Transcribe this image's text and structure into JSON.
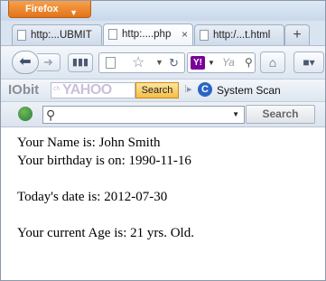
{
  "browser": {
    "menu_button": "Firefox",
    "tabs": [
      {
        "title": "http:...UBMIT",
        "active": false
      },
      {
        "title": "http:....php",
        "active": true
      },
      {
        "title": "http:/...t.html",
        "active": false
      }
    ],
    "new_tab_symbol": "+",
    "close_tab_symbol": "×"
  },
  "navbar": {
    "search_placeholder": "Ya",
    "search_engine_icon": "Y!"
  },
  "iobit_toolbar": {
    "logo": "IObit",
    "yahoo_field_text": "YAHOO",
    "search_button": "Search",
    "system_scan": "System Scan"
  },
  "find_toolbar": {
    "search_button": "Search"
  },
  "page": {
    "lines": [
      "Your Name is: John Smith",
      "Your birthday is on: 1990-11-16",
      "Today's date is: 2012-07-30",
      "Your current Age is: 21 yrs. Old."
    ]
  },
  "colors": {
    "menu_button": "#e8801f",
    "window_frame": "#d9e4f1",
    "yahoo_search_button": "#f6bd47",
    "page_background": "#ffffff"
  }
}
